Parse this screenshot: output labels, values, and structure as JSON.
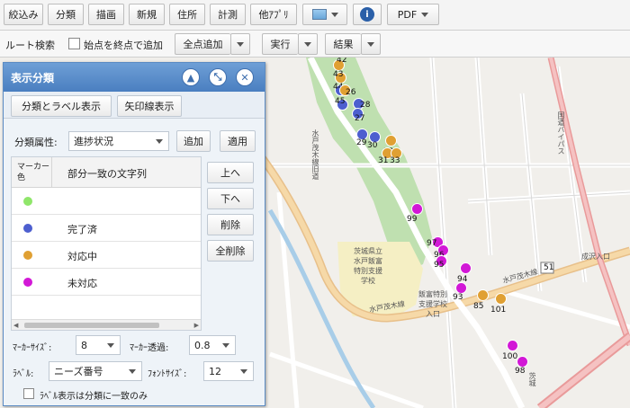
{
  "toolbar1": {
    "narrow": "絞込み",
    "classify": "分類",
    "draw": "描画",
    "new": "新規",
    "address": "住所",
    "measure": "計測",
    "other_app": "他ｱﾌﾟﾘ",
    "pdf": "PDF"
  },
  "toolbar2": {
    "route_search": "ルート検索",
    "add_start_as_end": "始点を終点で追加",
    "add_all_points": "全点追加",
    "execute": "実行",
    "result": "結果"
  },
  "panel": {
    "title": "表示分類",
    "tab_class_label": "分類とラベル表示",
    "tab_arrow": "矢印線表示",
    "attr_label": "分類属性:",
    "attr_value": "進捗状況",
    "add": "追加",
    "apply": "適用",
    "col_marker": "マーカー色",
    "col_partial": "部分一致の文字列",
    "rows": [
      {
        "color": "#8fe66a",
        "text": ""
      },
      {
        "color": "#4d5fcf",
        "text": "完了済"
      },
      {
        "color": "#e0a033",
        "text": "対応中"
      },
      {
        "color": "#d218d6",
        "text": "未対応"
      }
    ],
    "up": "上へ",
    "down": "下へ",
    "delete": "削除",
    "delete_all": "全削除",
    "marker_size_label": "ﾏｰｶｰｻｲｽﾞ:",
    "marker_size": "8",
    "marker_opacity_label": "ﾏｰｶｰ透過:",
    "marker_opacity": "0.8",
    "label_label": "ﾗﾍﾞﾙ:",
    "label_value": "ニーズ番号",
    "font_size_label": "ﾌｫﾝﾄｻｲｽﾞ:",
    "font_size": "12",
    "label_only_match": "ﾗﾍﾞﾙ表示は分類に一致のみ"
  },
  "map": {
    "facility1": "茨城県立\n水戸飯富\n特別支援\n学校",
    "facility2": "飯富特別\n支援学校\n入口",
    "road_mito_moki": "水戸茂木線",
    "road_mito_moki2": "水戸茂木線",
    "place_narusawa": "成沢入口",
    "route_51": "51",
    "bypass": "国道バイパス",
    "road_vertical": "水戸茂木線旧道",
    "area_label": "茨城",
    "markers": [
      {
        "n": "42",
        "color": "#e0a033"
      },
      {
        "n": "43",
        "color": "#e0a033"
      },
      {
        "n": "44",
        "color": "#4d5fcf"
      },
      {
        "n": "45",
        "color": "#4d5fcf"
      },
      {
        "n": "26",
        "color": "#e0a033"
      },
      {
        "n": "28",
        "color": "#4d5fcf"
      },
      {
        "n": "27",
        "color": "#4d5fcf"
      },
      {
        "n": "29",
        "color": "#4d5fcf"
      },
      {
        "n": "30",
        "color": "#4d5fcf"
      },
      {
        "n": "32",
        "color": "#e0a033"
      },
      {
        "n": "31",
        "color": "#e0a033"
      },
      {
        "n": "33",
        "color": "#e0a033"
      },
      {
        "n": "99",
        "color": "#d218d6"
      },
      {
        "n": "97",
        "color": "#d218d6"
      },
      {
        "n": "96",
        "color": "#d218d6"
      },
      {
        "n": "95",
        "color": "#d218d6"
      },
      {
        "n": "94",
        "color": "#d218d6"
      },
      {
        "n": "93",
        "color": "#d218d6"
      },
      {
        "n": "85",
        "color": "#e0a033"
      },
      {
        "n": "101",
        "color": "#e0a033"
      },
      {
        "n": "100",
        "color": "#d218d6"
      },
      {
        "n": "98",
        "color": "#d218d6"
      }
    ]
  }
}
